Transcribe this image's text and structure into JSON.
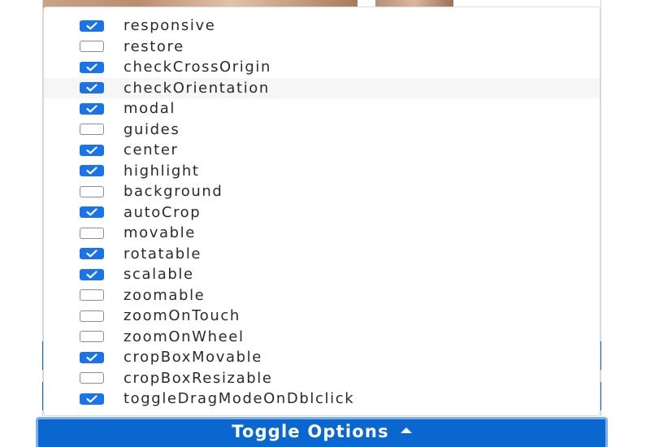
{
  "options": [
    {
      "label": "responsive",
      "checked": true
    },
    {
      "label": "restore",
      "checked": false
    },
    {
      "label": "checkCrossOrigin",
      "checked": true
    },
    {
      "label": "checkOrientation",
      "checked": true,
      "hovered": true
    },
    {
      "label": "modal",
      "checked": true
    },
    {
      "label": "guides",
      "checked": false
    },
    {
      "label": "center",
      "checked": true
    },
    {
      "label": "highlight",
      "checked": true
    },
    {
      "label": "background",
      "checked": false
    },
    {
      "label": "autoCrop",
      "checked": true
    },
    {
      "label": "movable",
      "checked": false
    },
    {
      "label": "rotatable",
      "checked": true
    },
    {
      "label": "scalable",
      "checked": true
    },
    {
      "label": "zoomable",
      "checked": false
    },
    {
      "label": "zoomOnTouch",
      "checked": false
    },
    {
      "label": "zoomOnWheel",
      "checked": false
    },
    {
      "label": "cropBoxMovable",
      "checked": true
    },
    {
      "label": "cropBoxResizable",
      "checked": false
    },
    {
      "label": "toggleDragModeOnDblclick",
      "checked": true
    }
  ],
  "toggle_button": {
    "label": "Toggle Options",
    "icon": "caret-up-icon"
  },
  "colors": {
    "accent": "#1a73e8",
    "button": "#0b67d0",
    "button_focus_ring": "#7fb0ec",
    "hover_row": "#f6f6f6"
  }
}
